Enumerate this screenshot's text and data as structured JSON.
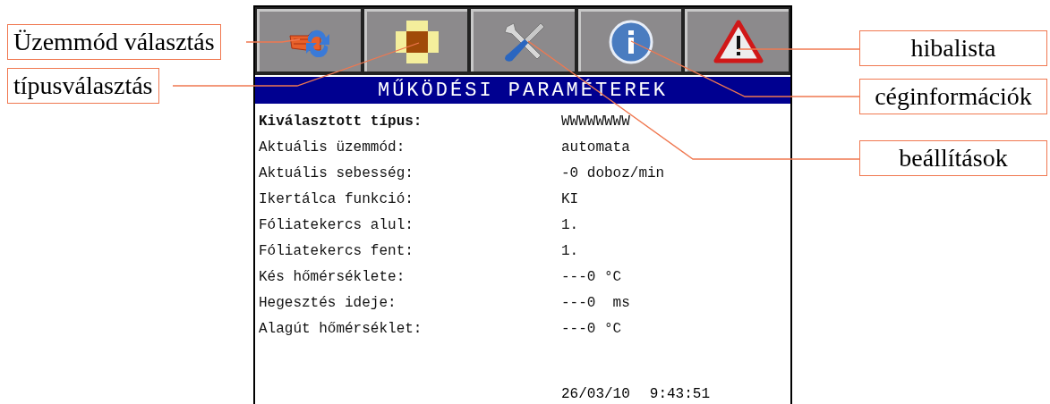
{
  "toolbar": {
    "buttons": [
      {
        "kind": "mode"
      },
      {
        "kind": "type"
      },
      {
        "kind": "settings"
      },
      {
        "kind": "info"
      },
      {
        "kind": "alarm"
      }
    ]
  },
  "title": "MŰKÖDÉSI PARAMÉTEREK",
  "parameters": [
    {
      "label": "Kiválasztott típus:",
      "value": "WWWWWWWW",
      "emphasized": true
    },
    {
      "label": "Aktuális üzemmód:",
      "value": "automata",
      "emphasized": false
    },
    {
      "label": "Aktuális sebesség:",
      "value": "-0 doboz/min",
      "emphasized": false
    },
    {
      "label": "Ikertálca funkció:",
      "value": "KI",
      "emphasized": false
    },
    {
      "label": "Fóliatekercs alul:",
      "value": "1.",
      "emphasized": false
    },
    {
      "label": "Fóliatekercs fent:",
      "value": "1.",
      "emphasized": false
    },
    {
      "label": "Kés hőmérséklete:",
      "value": "---0 °C",
      "emphasized": false
    },
    {
      "label": "Hegesztés ideje:",
      "value": "---0  ms",
      "emphasized": false
    },
    {
      "label": "Alagút hőmérséklet:",
      "value": "---0 °C",
      "emphasized": false
    }
  ],
  "date": "26/03/10",
  "time": "9:43:51",
  "callouts": [
    {
      "label": "Üzemmód választás"
    },
    {
      "label": "típusválasztás"
    },
    {
      "label": "hibalista"
    },
    {
      "label": "céginformációk"
    },
    {
      "label": "beállítások"
    }
  ]
}
